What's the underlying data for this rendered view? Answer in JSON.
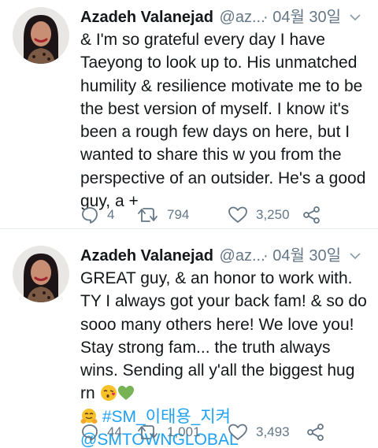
{
  "tweets": [
    {
      "name": "Azadeh Valanejad",
      "handle": "@az...",
      "date": "· 04월 30일",
      "text": "& I'm so grateful every day I have Taeyong to look up to. His unmatched humility & resilience motivate me to be the best version of myself. I know it's been a rough few days on here, but I wanted to share this w you from the perspective of an outsider. He's a good guy, a +",
      "replies": "4",
      "retweets": "794",
      "likes": "3,250"
    },
    {
      "name": "Azadeh Valanejad",
      "handle": "@az...",
      "date": "· 04월 30일",
      "text": "GREAT guy, & an honor to work with. TY I always got your back fam! & so do sooo many others here! We love you! Stay strong fam... the truth always wins. Sending all y'all the biggest hug rn",
      "hashtag": "#SM_이태용_지켜",
      "mention": "@SMTOWNGLOBAL",
      "replies": "44",
      "retweets": "1,001",
      "likes": "3,493"
    }
  ],
  "icons": {
    "reply": "speech-bubble-icon",
    "retweet": "retweet-arrows-icon",
    "like": "heart-outline-icon",
    "share": "share-nodes-icon",
    "caret": "chevron-down-icon",
    "emoji_kiss": "face-blowing-kiss-emoji",
    "emoji_heart": "green-heart-emoji",
    "emoji_hug": "hugging-face-emoji"
  },
  "colors": {
    "text": "#14171a",
    "secondary": "#657786",
    "link": "#1da1f2",
    "divider": "#e1e8ed"
  }
}
